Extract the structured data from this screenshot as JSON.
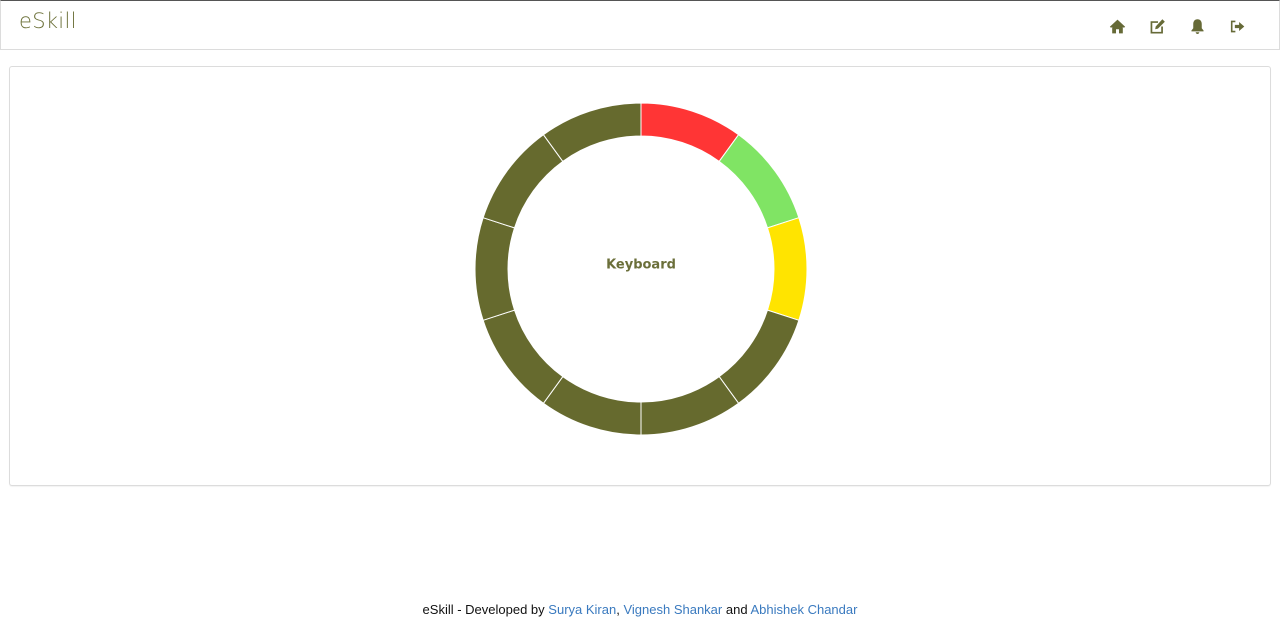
{
  "navbar": {
    "brand": "eSkill",
    "icons": [
      "home-icon",
      "edit-icon",
      "bell-icon",
      "sign-out-icon"
    ]
  },
  "colors": {
    "accent": "#666a2e",
    "red": "#ff3535",
    "green": "#80e464",
    "yellow": "#ffe400",
    "link": "#3a7abf"
  },
  "wheel": {
    "center_label": "Keyboard",
    "segments": [
      {
        "status": "red"
      },
      {
        "status": "green"
      },
      {
        "status": "yellow"
      },
      {
        "status": "default"
      },
      {
        "status": "default"
      },
      {
        "status": "default"
      },
      {
        "status": "default"
      },
      {
        "status": "default"
      },
      {
        "status": "default"
      },
      {
        "status": "default"
      }
    ]
  },
  "footer": {
    "prefix": "eSkill - Developed by",
    "author1": "Surya Kiran",
    "sep1": ",",
    "author2": "Vignesh Shankar",
    "and": "and",
    "author3": "Abhishek Chandar"
  }
}
